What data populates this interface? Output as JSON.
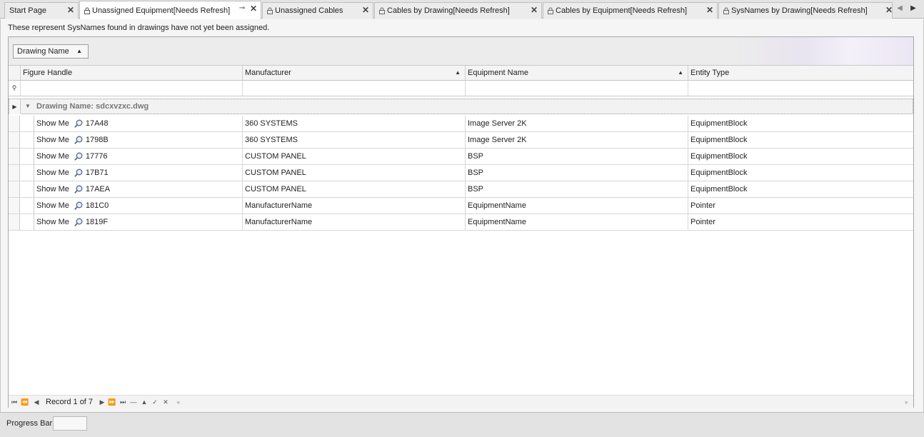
{
  "tabs": [
    {
      "label": "Start Page",
      "locked": false,
      "active": false
    },
    {
      "label": "Unassigned Equipment[Needs Refresh]",
      "locked": true,
      "active": true
    },
    {
      "label": "Unassigned Cables",
      "locked": true,
      "active": false
    },
    {
      "label": "Cables by Drawing[Needs Refresh]",
      "locked": true,
      "active": false
    },
    {
      "label": "Cables by Equipment[Needs Refresh]",
      "locked": true,
      "active": false
    },
    {
      "label": "SysNames by Drawing[Needs Refresh]",
      "locked": true,
      "active": false
    }
  ],
  "description": "These represent SysNames found in drawings have not yet been assigned.",
  "group_panel": {
    "chip_label": "Drawing Name"
  },
  "columns": [
    {
      "label": "Figure Handle",
      "sorted": false
    },
    {
      "label": "Manufacturer",
      "sorted": "asc"
    },
    {
      "label": "Equipment Name",
      "sorted": "asc"
    },
    {
      "label": "Entity Type",
      "sorted": false
    }
  ],
  "group": {
    "label": "Drawing Name: sdcxvzxc.dwg"
  },
  "rows": [
    {
      "show_me": "Show Me",
      "handle": "17A48",
      "manufacturer": "360 SYSTEMS",
      "equipment": "Image Server 2K",
      "entity": "EquipmentBlock"
    },
    {
      "show_me": "Show Me",
      "handle": "1798B",
      "manufacturer": "360 SYSTEMS",
      "equipment": "Image Server 2K",
      "entity": "EquipmentBlock"
    },
    {
      "show_me": "Show Me",
      "handle": "17776",
      "manufacturer": "CUSTOM PANEL",
      "equipment": "BSP",
      "entity": "EquipmentBlock"
    },
    {
      "show_me": "Show Me",
      "handle": "17B71",
      "manufacturer": "CUSTOM PANEL",
      "equipment": "BSP",
      "entity": "EquipmentBlock"
    },
    {
      "show_me": "Show Me",
      "handle": "17AEA",
      "manufacturer": "CUSTOM PANEL",
      "equipment": "BSP",
      "entity": "EquipmentBlock"
    },
    {
      "show_me": "Show Me",
      "handle": "181C0",
      "manufacturer": "ManufacturerName",
      "equipment": "EquipmentName",
      "entity": "Pointer"
    },
    {
      "show_me": "Show Me",
      "handle": "1819F",
      "manufacturer": "ManufacturerName",
      "equipment": "EquipmentName",
      "entity": "Pointer"
    }
  ],
  "navigator": {
    "record_text": "Record 1 of 7"
  },
  "status": {
    "progress_label": "Progress Bar"
  }
}
